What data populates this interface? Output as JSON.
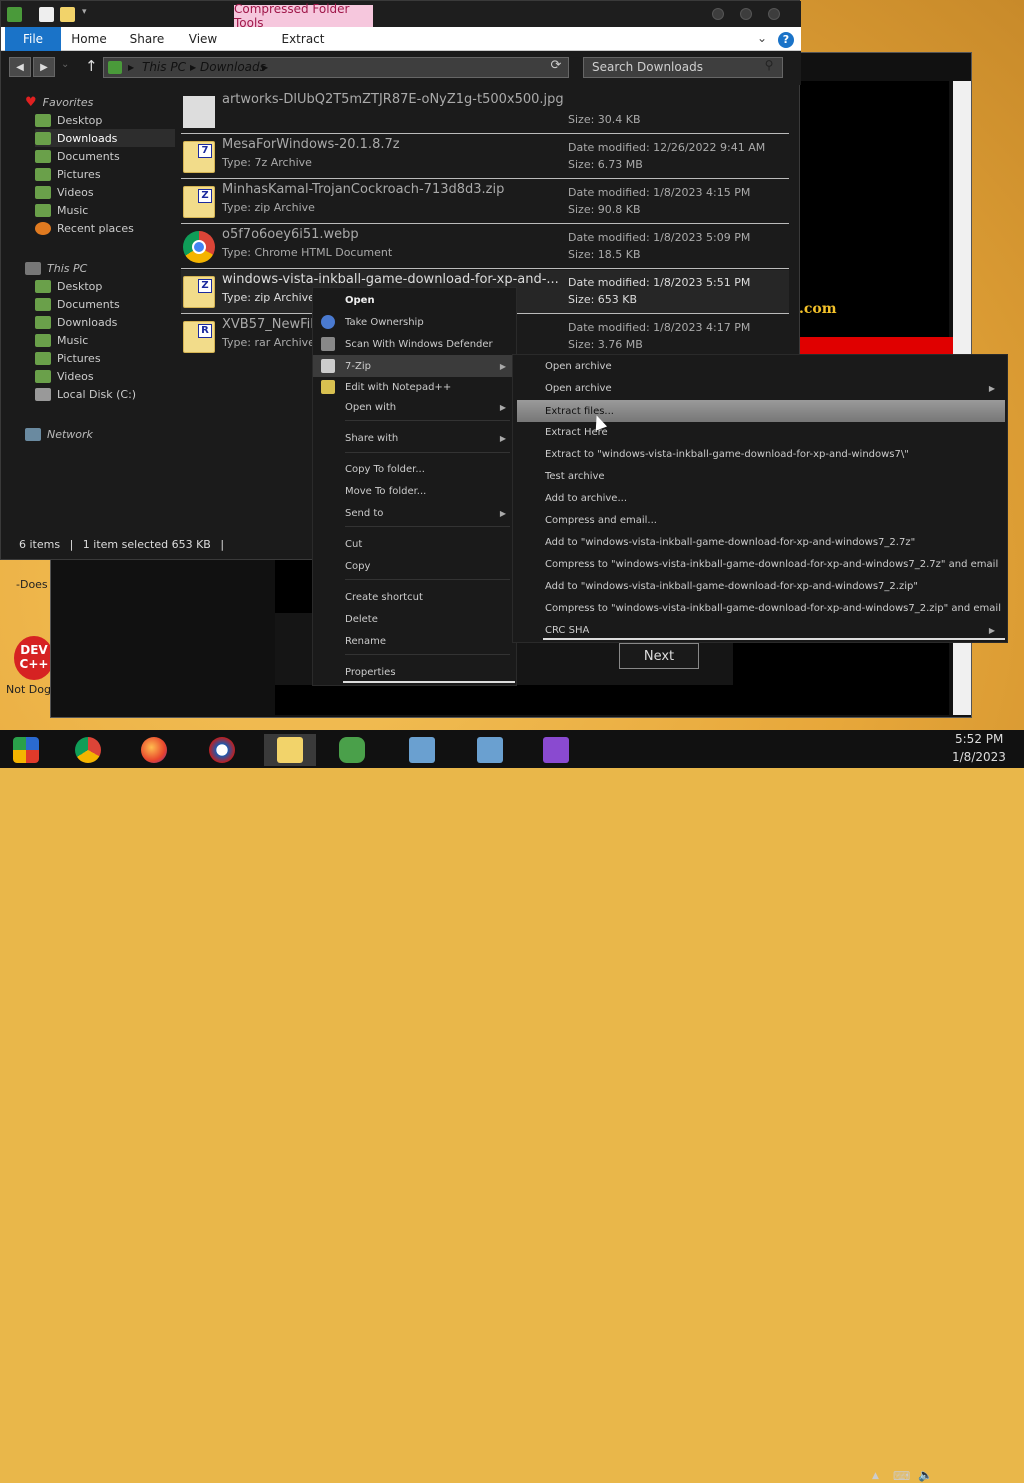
{
  "desktop": {
    "label_top": "-Does",
    "label_bottom": "Not Dog",
    "devcpp_text": "DEV C++"
  },
  "backwin": {
    "dotcom": ".com",
    "next_label": "Next"
  },
  "explorer": {
    "context_tab": "Compressed Folder Tools",
    "ribbon_tabs": [
      "File",
      "Home",
      "Share",
      "View",
      "Extract"
    ],
    "help": "?",
    "address": [
      "This PC",
      "Downloads"
    ],
    "search_placeholder": "Search Downloads",
    "favorites": {
      "header": "Favorites",
      "items": [
        "Desktop",
        "Downloads",
        "Documents",
        "Pictures",
        "Videos",
        "Music",
        "Recent places"
      ]
    },
    "thispc": {
      "header": "This PC",
      "items": [
        "Desktop",
        "Documents",
        "Downloads",
        "Music",
        "Pictures",
        "Videos",
        "Local Disk (C:)"
      ]
    },
    "network": "Network",
    "files": [
      {
        "name": "artworks-DlUbQ2T5mZTJR87E-oNyZ1g-t500x500.jpg",
        "type": "",
        "meta1": "",
        "meta2": "Size: 30.4 KB",
        "icon": "image"
      },
      {
        "name": "MesaForWindows-20.1.8.7z",
        "type": "Type: 7z Archive",
        "meta1": "Date modified: 12/26/2022 9:41 AM",
        "meta2": "Size: 6.73 MB",
        "icon": "7z",
        "badge": "7"
      },
      {
        "name": "MinhasKamal-TrojanCockroach-713d8d3.zip",
        "type": "Type: zip Archive",
        "meta1": "Date modified: 1/8/2023 4:15 PM",
        "meta2": "Size: 90.8 KB",
        "icon": "zip",
        "badge": "Z"
      },
      {
        "name": "o5f7o6oey6i51.webp",
        "type": "Type: Chrome HTML Document",
        "meta1": "Date modified: 1/8/2023 5:09 PM",
        "meta2": "Size: 18.5 KB",
        "icon": "chrome"
      },
      {
        "name": "windows-vista-inkball-game-download-for-xp-and-...",
        "type": "Type: zip Archive",
        "meta1": "Date modified: 1/8/2023 5:51 PM",
        "meta2": "Size: 653 KB",
        "icon": "zip",
        "badge": "Z"
      },
      {
        "name": "XVB57_NewFil",
        "type": "Type: rar Archive",
        "meta1": "Date modified: 1/8/2023 4:17 PM",
        "meta2": "Size: 3.76 MB",
        "icon": "rar",
        "badge": "R"
      }
    ],
    "status": [
      "6 items",
      "1 item selected  653 KB"
    ]
  },
  "context_menu": {
    "items": [
      "Open",
      "Take Ownership",
      "Scan With Windows Defender",
      "7-Zip",
      "Edit with Notepad++",
      "Open with",
      "Share with",
      "Copy To folder...",
      "Move To folder...",
      "Send to",
      "Cut",
      "Copy",
      "Create shortcut",
      "Delete",
      "Rename",
      "Properties"
    ]
  },
  "submenu": {
    "items": [
      "Open archive",
      "Open archive",
      "Extract files...",
      "Extract Here",
      "Extract to \"windows-vista-inkball-game-download-for-xp-and-windows7\\\"",
      "Test archive",
      "Add to archive...",
      "Compress and email...",
      "Add to \"windows-vista-inkball-game-download-for-xp-and-windows7_2.7z\"",
      "Compress to \"windows-vista-inkball-game-download-for-xp-and-windows7_2.7z\" and email",
      "Add to \"windows-vista-inkball-game-download-for-xp-and-windows7_2.zip\"",
      "Compress to \"windows-vista-inkball-game-download-for-xp-and-windows7_2.zip\" and email",
      "CRC SHA"
    ]
  },
  "taskbar": {
    "time": "5:52 PM",
    "date": "1/8/2023"
  }
}
